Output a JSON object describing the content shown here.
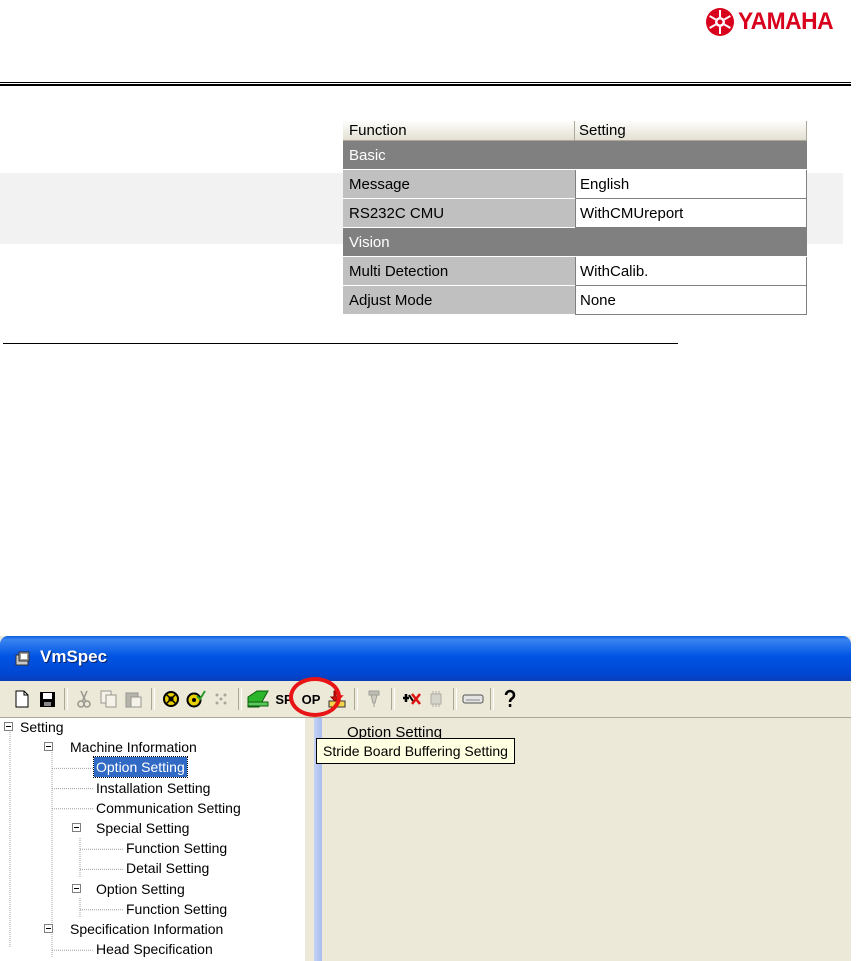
{
  "logo": {
    "text": "YAMAHA",
    "color": "#d8001c"
  },
  "window": {
    "title": "VmSpec",
    "toolbar": {
      "sp_label": "SP",
      "op_label": "OP",
      "tooltip": "Stride Board Buffering Setting",
      "highlight_color": "#e81416"
    },
    "tree": [
      {
        "label": "Setting",
        "level": 0,
        "expanded": true
      },
      {
        "label": "Machine Information",
        "level": 1,
        "expanded": true
      },
      {
        "label": "Option Setting",
        "level": 2,
        "selected": true
      },
      {
        "label": "Installation Setting",
        "level": 2
      },
      {
        "label": "Communication Setting",
        "level": 2
      },
      {
        "label": "Special Setting",
        "level": 2,
        "expanded": true
      },
      {
        "label": "Function Setting",
        "level": 3
      },
      {
        "label": "Detail Setting",
        "level": 3
      },
      {
        "label": "Option Setting",
        "level": 2,
        "expanded": true
      },
      {
        "label": "Function Setting",
        "level": 3
      },
      {
        "label": "Specification Information",
        "level": 1,
        "expanded": true
      },
      {
        "label": "Head Specification",
        "level": 2
      }
    ],
    "pane_title": "Option Setting",
    "grid": {
      "headers": {
        "function": "Function",
        "setting": "Setting"
      },
      "rows": [
        {
          "type": "group",
          "function": "Basic",
          "setting": ""
        },
        {
          "type": "item",
          "function": "Message",
          "setting": "English"
        },
        {
          "type": "item",
          "function": "RS232C CMU",
          "setting": "WithCMUreport"
        },
        {
          "type": "group",
          "function": "Vision",
          "setting": ""
        },
        {
          "type": "item",
          "function": "Multi Detection",
          "setting": "WithCalib."
        },
        {
          "type": "item",
          "function": "Adjust Mode",
          "setting": "None"
        }
      ]
    }
  }
}
